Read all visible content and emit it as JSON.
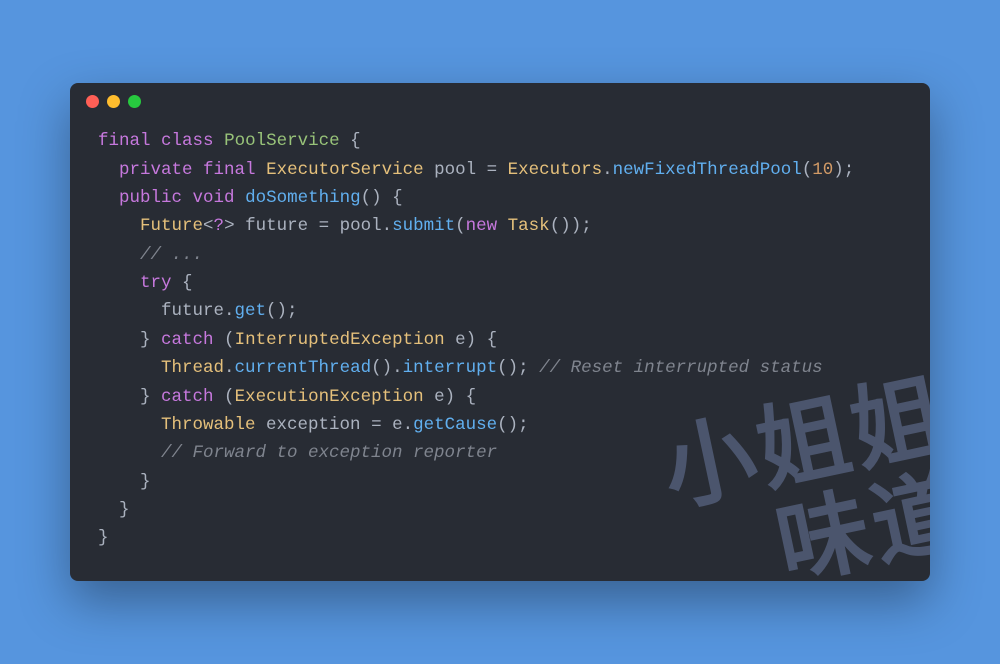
{
  "window": {
    "traffic_lights": [
      "red",
      "yellow",
      "green"
    ]
  },
  "watermark": {
    "line1": "小姐姐",
    "line2": "味道"
  },
  "code": {
    "l1": {
      "kw_final": "final",
      "kw_class": "class",
      "classname": "PoolService",
      "brace": " {"
    },
    "l2": {
      "indent": "  ",
      "kw_private": "private",
      "kw_final": "final",
      "type": "ExecutorService",
      "var": " pool ",
      "eq": "= ",
      "owner": "Executors",
      "dot": ".",
      "fn": "newFixedThreadPool",
      "open": "(",
      "num": "10",
      "close": ");"
    },
    "l3": {
      "indent": "  ",
      "kw_public": "public",
      "kw_void": "void",
      "sp": " ",
      "fn": "doSomething",
      "parens": "()",
      "brace": " {"
    },
    "l4": {
      "indent": "    ",
      "type": "Future",
      "lt": "<",
      "q": "?",
      "gt": ">",
      "var": " future ",
      "eq": "= pool.",
      "fn": "submit",
      "open": "(",
      "kw_new": "new",
      "sp": " ",
      "ctor": "Task",
      "close": "());"
    },
    "l5": {
      "indent": "    ",
      "comment": "// ..."
    },
    "l6": {
      "indent": "    ",
      "kw_try": "try",
      "brace": " {"
    },
    "l7": {
      "indent": "      ",
      "expr_a": "future.",
      "fn": "get",
      "tail": "();"
    },
    "l8": {
      "indent": "    ",
      "close": "} ",
      "kw_catch": "catch",
      "open": " (",
      "type": "InterruptedException",
      "var": " e",
      "close2": ") {"
    },
    "l9": {
      "indent": "      ",
      "owner": "Thread",
      "dot1": ".",
      "fn1": "currentThread",
      "p1": "().",
      "fn2": "interrupt",
      "p2": "(); ",
      "comment": "// Reset interrupted status"
    },
    "l10": {
      "indent": "    ",
      "close": "} ",
      "kw_catch": "catch",
      "open": " (",
      "type": "ExecutionException",
      "var": " e",
      "close2": ") {"
    },
    "l11": {
      "indent": "      ",
      "type": "Throwable",
      "var": " exception ",
      "eq": "= e.",
      "fn": "getCause",
      "tail": "();"
    },
    "l12": {
      "indent": "      ",
      "comment": "// Forward to exception reporter"
    },
    "l13": {
      "indent": "    ",
      "brace": "}"
    },
    "l14": {
      "indent": "  ",
      "brace": "}"
    },
    "l15": {
      "indent": "",
      "brace": "}"
    }
  }
}
